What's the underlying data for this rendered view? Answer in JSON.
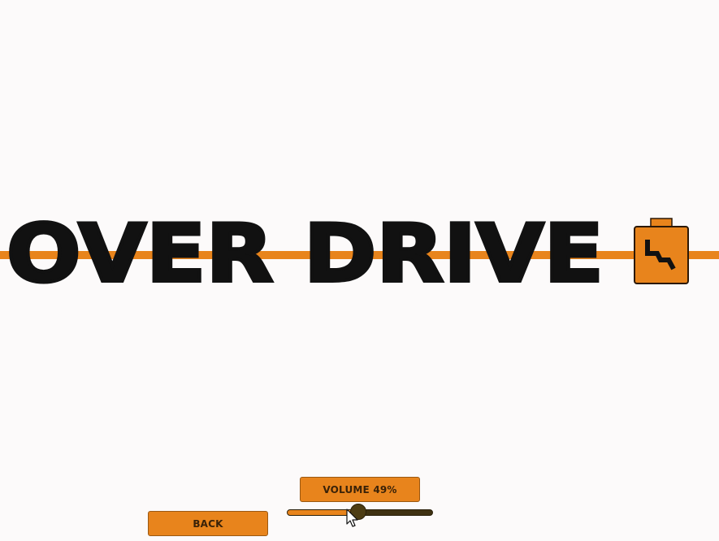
{
  "title": {
    "text": "OVER DRIVE",
    "logo_icon": "battery-bolt-icon"
  },
  "menu": {
    "volume_label": "VOLUME 49%",
    "volume_value": 49,
    "back_label": "BACK"
  },
  "colors": {
    "accent": "#e8841c",
    "title_text": "#111111",
    "slider_track": "#3f3212",
    "background": "#fcfafa"
  },
  "icons": {
    "cursor": "mouse-pointer-icon"
  }
}
